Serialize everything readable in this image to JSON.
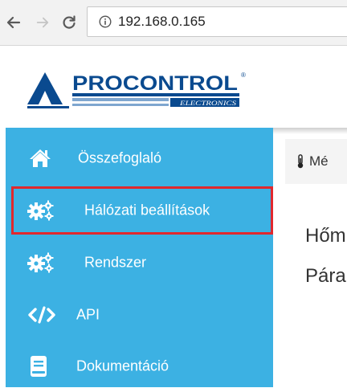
{
  "browser": {
    "url": "192.168.0.165",
    "icons": {
      "back": "arrow-left-icon",
      "forward": "arrow-right-icon",
      "reload": "reload-icon",
      "info": "info-icon"
    }
  },
  "logo": {
    "brand": "PROCONTROL",
    "sub": "ELECTRONICS",
    "registered": "®",
    "colors": {
      "primary": "#0a4a8f",
      "light": "#7fa6cf"
    }
  },
  "sidebar": {
    "background": "#3cb1e3",
    "items": [
      {
        "label": "Összefoglaló",
        "icon": "home-icon"
      },
      {
        "label": "Hálózati beállítások",
        "icon": "cogs-icon",
        "highlighted": true
      },
      {
        "label": "Rendszer",
        "icon": "cogs-icon"
      },
      {
        "label": "API",
        "icon": "code-icon"
      },
      {
        "label": "Dokumentáció",
        "icon": "book-icon"
      }
    ]
  },
  "main": {
    "breadcrumb": {
      "icon": "thermometer-icon",
      "text": "Mé"
    },
    "lines": [
      "Hőm",
      "Pára"
    ]
  },
  "highlight_color": "#e0282e"
}
